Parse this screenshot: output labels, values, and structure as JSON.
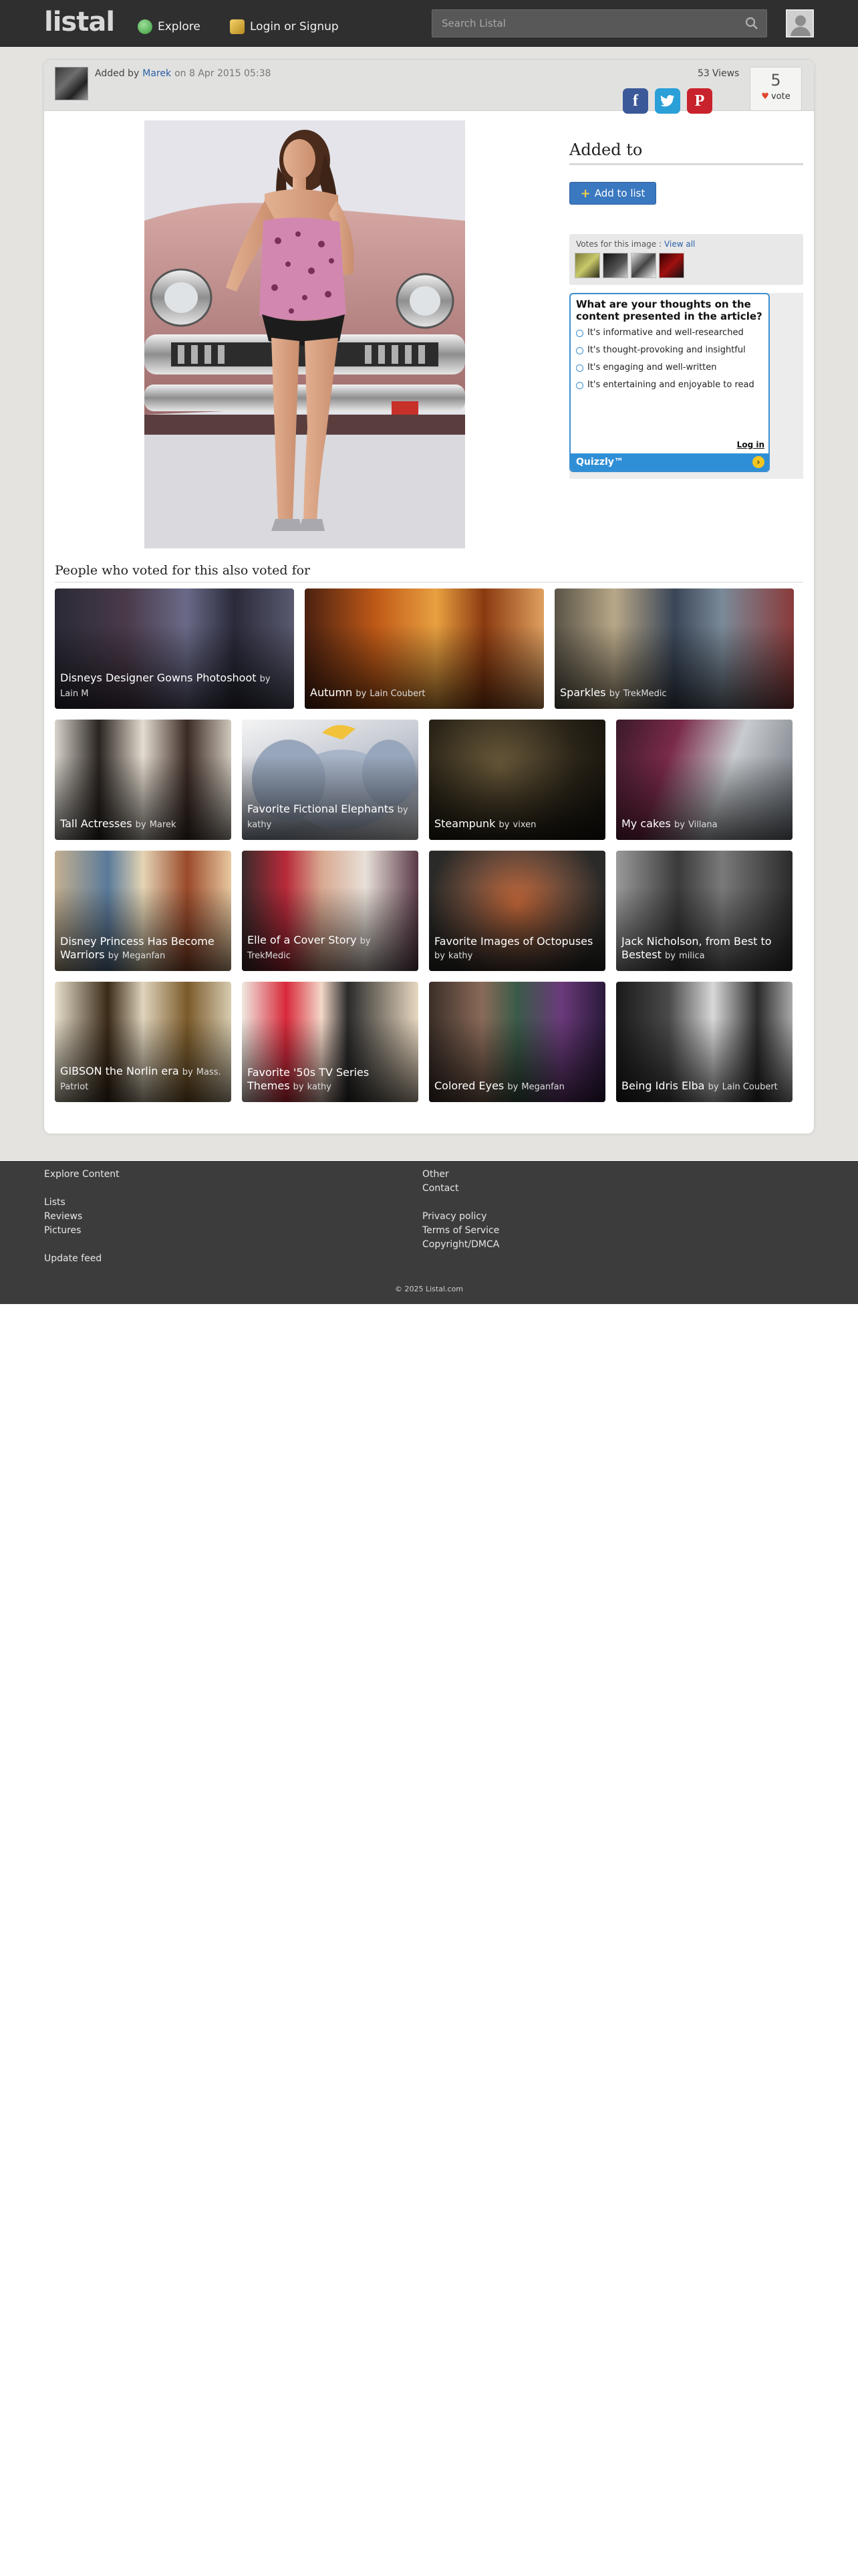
{
  "header": {
    "logo": "listal",
    "explore": "Explore",
    "login": "Login or Signup",
    "search_placeholder": "Search Listal"
  },
  "image_info": {
    "added_prefix": "Added by",
    "user": "Marek",
    "date": "on 8 Apr 2015 05:38",
    "views": "53",
    "views_label": "Views",
    "votes": "5",
    "vote_label": "vote"
  },
  "sidebar": {
    "added_to": "Added to",
    "add_to_list": "Add to list",
    "votes_label": "Votes for this image :",
    "view_all": "View all"
  },
  "quiz": {
    "question": "What are your thoughts on the content presented in the article?",
    "options": [
      "It's informative and well-researched",
      "It's thought-provoking and insightful",
      "It's engaging and well-written",
      "It's entertaining and enjoyable to read"
    ],
    "login": "Log in",
    "brand": "Quizzly™"
  },
  "also_voted": {
    "title": "People who voted for this also voted for",
    "lists": [
      {
        "title": "Disneys Designer Gowns Photoshoot",
        "by": "by",
        "author": "Lain M"
      },
      {
        "title": "Autumn",
        "by": "by",
        "author": "Lain Coubert"
      },
      {
        "title": "Sparkles",
        "by": "by",
        "author": "TrekMedic"
      },
      {
        "title": "Tall Actresses",
        "by": "by",
        "author": "Marek"
      },
      {
        "title": "Favorite Fictional Elephants",
        "by": "by",
        "author": "kathy"
      },
      {
        "title": "Steampunk",
        "by": "by",
        "author": "vixen"
      },
      {
        "title": "My cakes",
        "by": "by",
        "author": "Villana"
      },
      {
        "title": "Disney Princess Has Become Warriors",
        "by": "by",
        "author": "Meganfan"
      },
      {
        "title": "Elle of a Cover Story",
        "by": "by",
        "author": "TrekMedic"
      },
      {
        "title": "Favorite Images of Octopuses",
        "by": "by",
        "author": "kathy"
      },
      {
        "title": "Jack Nicholson, from Best to Bestest",
        "by": "by",
        "author": "milica"
      },
      {
        "title": "GIBSON the Norlin era",
        "by": "by",
        "author": "Mass. Patriot"
      },
      {
        "title": "Favorite '50s TV Series Themes",
        "by": "by",
        "author": "kathy"
      },
      {
        "title": "Colored Eyes",
        "by": "by",
        "author": "Meganfan"
      },
      {
        "title": "Being Idris Elba",
        "by": "by",
        "author": "Lain Coubert"
      }
    ]
  },
  "footer": {
    "explore_heading": "Explore Content",
    "lists": "Lists",
    "reviews": "Reviews",
    "pictures": "Pictures",
    "update_feed": "Update feed",
    "other": "Other",
    "contact": "Contact",
    "privacy": "Privacy policy",
    "terms": "Terms of Service",
    "copyright_dmca": "Copyright/DMCA",
    "copyright": "© 2025 Listal.com"
  },
  "colors": {
    "topbar": "#2f2f2f",
    "link": "#2b5fa8",
    "add_button": "#3a78c0",
    "quiz_accent": "#2f8fd6",
    "footer": "#3c3c3c"
  }
}
